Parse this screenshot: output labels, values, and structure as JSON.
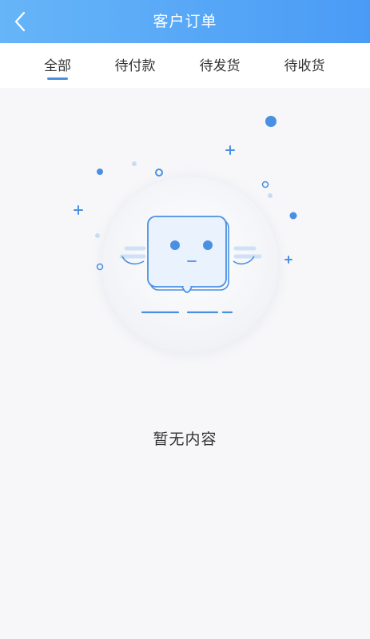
{
  "header": {
    "title": "客户订单",
    "back_icon": "chevron-left-icon"
  },
  "tabs": [
    {
      "label": "全部",
      "active": true
    },
    {
      "label": "待付款",
      "active": false
    },
    {
      "label": "待发货",
      "active": false
    },
    {
      "label": "待收货",
      "active": false
    }
  ],
  "empty_state": {
    "message": "暂无内容",
    "illustration": "empty-box-face-illustration"
  },
  "colors": {
    "header_gradient_start": "#66b5f8",
    "header_gradient_end": "#4a9bf6",
    "accent": "#4a90e2",
    "background": "#f7f7f9"
  }
}
